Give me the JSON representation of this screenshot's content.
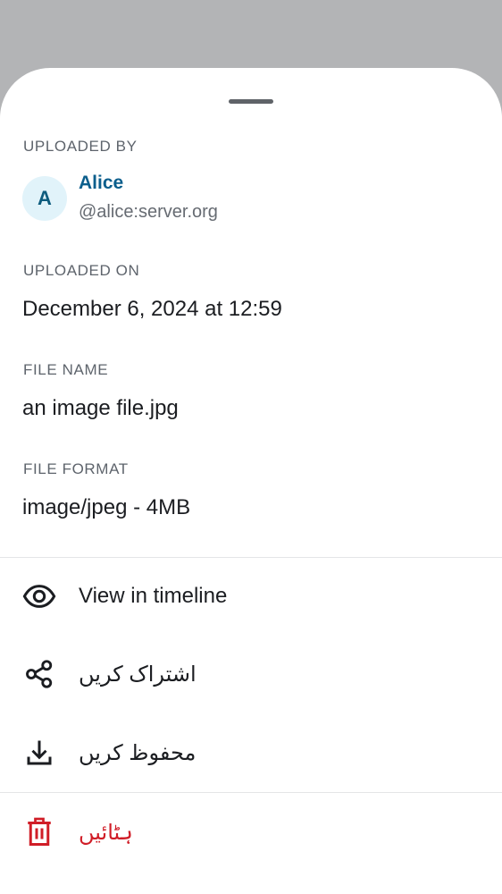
{
  "uploader": {
    "section_label": "UPLOADED BY",
    "avatar_initial": "A",
    "name": "Alice",
    "user_id": "@alice:server.org"
  },
  "upload_date": {
    "section_label": "UPLOADED ON",
    "value": "December 6, 2024 at 12:59"
  },
  "file_name": {
    "section_label": "FILE NAME",
    "value": "an image file.jpg"
  },
  "file_format": {
    "section_label": "FILE FORMAT",
    "value": "image/jpeg - 4MB"
  },
  "actions": [
    {
      "label": "View in timeline",
      "icon": "eye-icon"
    },
    {
      "label": "اشتراک کریں",
      "icon": "share-icon"
    },
    {
      "label": "محفوظ کریں",
      "icon": "download-icon"
    },
    {
      "label": "ہٹائیں",
      "icon": "trash-icon"
    }
  ],
  "colors": {
    "scrim": "#b3b4b6",
    "accent_name": "#0b5e8c",
    "avatar_bg": "#e1f3fa",
    "danger": "#d01d27"
  }
}
